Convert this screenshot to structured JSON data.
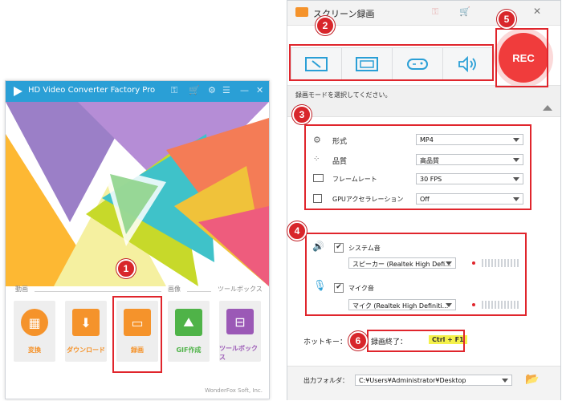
{
  "app": {
    "title": "HD Video Converter Factory Pro",
    "categories": [
      "動画",
      "画像",
      "ツールボックス"
    ],
    "tiles": [
      {
        "label": "変換",
        "color": "#f5932b",
        "icon": "film-icon"
      },
      {
        "label": "ダウンロード",
        "color": "#f5932b",
        "icon": "download-icon"
      },
      {
        "label": "録画",
        "color": "#f5932b",
        "icon": "monitor-icon"
      },
      {
        "label": "GIF作成",
        "color": "#4fb348",
        "icon": "image-icon"
      },
      {
        "label": "ツールボックス",
        "color": "#9b59b6",
        "icon": "toolbox-icon"
      }
    ],
    "footer": "WonderFox Soft, Inc."
  },
  "recorder": {
    "title": "スクリーン録画",
    "rec_label": "REC",
    "hint": "録画モードを選択してください。",
    "settings": [
      {
        "label": "形式",
        "value": "MP4",
        "icon": "gear-icon"
      },
      {
        "label": "品質",
        "value": "高品質",
        "icon": "quality-icon"
      },
      {
        "label": "フレームレート",
        "value": "30 FPS",
        "icon": "frame-icon"
      },
      {
        "label": "GPUアクセラレーション",
        "value": "Off",
        "icon": "gpu-icon"
      }
    ],
    "audio": {
      "system_label": "システム音",
      "system_device": "スピーカー (Realtek High Defi...",
      "mic_label": "マイク音",
      "mic_device": "マイク (Realtek High Definiti..."
    },
    "hotkey_label": "ホットキー：",
    "hotkey_action": "録画終了：",
    "hotkey_keys": "Ctrl + F1",
    "output_label": "出力フォルダ：",
    "output_path": "C:¥Users¥Administrator¥Desktop"
  },
  "badges": [
    "1",
    "2",
    "3",
    "4",
    "5",
    "6"
  ],
  "colors": {
    "accent": "#2a9fd6",
    "rec": "#f03c3c",
    "highlight": "#e0252c"
  }
}
